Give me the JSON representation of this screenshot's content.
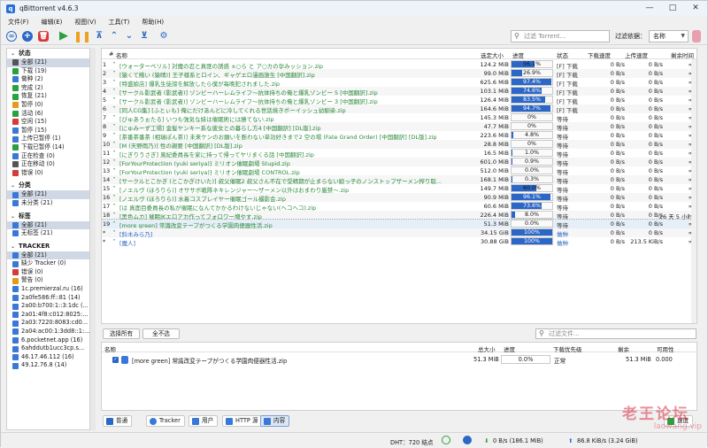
{
  "app": {
    "title": "qBittorrent v4.6.3"
  },
  "menu": [
    "文件(F)",
    "编辑(E)",
    "视图(V)",
    "工具(T)",
    "帮助(H)"
  ],
  "toolbar": {
    "filter_placeholder": "过滤 Torrent...",
    "filter_label": "过滤依据：",
    "filter_by": "名称"
  },
  "sidebar": {
    "status_title": "状态",
    "status": [
      {
        "label": "全部 (21)",
        "icon": "all-icon",
        "color": "#555555"
      },
      {
        "label": "下载 (19)",
        "icon": "download-icon",
        "color": "#2aa040"
      },
      {
        "label": "做种 (2)",
        "icon": "seed-icon",
        "color": "#3a78d8"
      },
      {
        "label": "完成 (2)",
        "icon": "check-icon",
        "color": "#2aa040"
      },
      {
        "label": "恢复 (21)",
        "icon": "resume-icon",
        "color": "#2aa040"
      },
      {
        "label": "暂停 (0)",
        "icon": "pause-icon",
        "color": "#e49a1a"
      },
      {
        "label": "活动 (6)",
        "icon": "active-icon",
        "color": "#2aa040"
      },
      {
        "label": "空闲 (15)",
        "icon": "idle-icon",
        "color": "#d43b3b"
      },
      {
        "label": "暂停 (15)",
        "icon": "stalled-icon",
        "color": "#3a78d8"
      },
      {
        "label": "上传已暂停 (1)",
        "icon": "upload-stalled-icon",
        "color": "#3a78d8"
      },
      {
        "label": "下载已暂停 (14)",
        "icon": "download-stalled-icon",
        "color": "#2aa040"
      },
      {
        "label": "正在检查 (0)",
        "icon": "checking-icon",
        "color": "#3a78d8"
      },
      {
        "label": "正在移动 (0)",
        "icon": "moving-icon",
        "color": "#555555"
      },
      {
        "label": "错误 (0)",
        "icon": "error-icon",
        "color": "#d43b3b"
      }
    ],
    "category_title": "分类",
    "category": [
      {
        "label": "全部 (21)",
        "icon": "folder-icon",
        "color": "#3a78d8"
      },
      {
        "label": "未分类 (21)",
        "icon": "folder-icon",
        "color": "#3a78d8"
      }
    ],
    "tag_title": "标签",
    "tag": [
      {
        "label": "全部 (21)",
        "icon": "tag-icon",
        "color": "#3a78d8"
      },
      {
        "label": "无标签 (21)",
        "icon": "tag-icon",
        "color": "#3a78d8"
      }
    ],
    "tracker_title": "TRACKER",
    "tracker": [
      {
        "label": "全部 (21)",
        "icon": "pin-icon",
        "color": "#3a78d8"
      },
      {
        "label": "缺少 Tracker (0)",
        "icon": "pin-icon",
        "color": "#3a78d8"
      },
      {
        "label": "错误 (0)",
        "icon": "error-icon",
        "color": "#d43b3b"
      },
      {
        "label": "警告 (0)",
        "icon": "warning-icon",
        "color": "#e49a1a"
      },
      {
        "label": "1c.premierzal.ru (16)",
        "icon": "pin-icon",
        "color": "#3a78d8"
      },
      {
        "label": "2a0fe586:ff::81 (14)",
        "icon": "pin-icon",
        "color": "#3a78d8"
      },
      {
        "label": "2a00:b700:1::3:1dc (...",
        "icon": "pin-icon",
        "color": "#3a78d8"
      },
      {
        "label": "2a01:4f8:c012:8025:...",
        "icon": "pin-icon",
        "color": "#3a78d8"
      },
      {
        "label": "2a03:7220:8083:cd0...",
        "icon": "pin-icon",
        "color": "#3a78d8"
      },
      {
        "label": "2a04:ac00:1:3dd8::1:...",
        "icon": "pin-icon",
        "color": "#3a78d8"
      },
      {
        "label": "6.pocketnet.app (16)",
        "icon": "pin-icon",
        "color": "#3a78d8"
      },
      {
        "label": "6ahddutb1ucc3cp.s...",
        "icon": "pin-icon",
        "color": "#3a78d8"
      },
      {
        "label": "46.17.46.112 (16)",
        "icon": "pin-icon",
        "color": "#3a78d8"
      },
      {
        "label": "49.12.76.8 (14)",
        "icon": "pin-icon",
        "color": "#3a78d8"
      }
    ]
  },
  "table": {
    "headers": {
      "num": "#",
      "name": "名称",
      "size": "选定大小",
      "progress": "进度",
      "status": "状态",
      "dl": "下载速度",
      "ul": "上传速度",
      "eta": "剩余时间"
    },
    "rows": [
      {
        "n": "1",
        "name": "[ウォーターベリル] 対魔の忍と真匪の誘惑 ±○ら と ア○カの孕みッション.zip",
        "size": "124.2 MiB",
        "progress": 56.1,
        "pt": "56.1%",
        "status": "[F] 下载",
        "dl": "0 B/s",
        "ul": "0 B/s",
        "eta": "∞"
      },
      {
        "n": "2",
        "name": "[猿くて賤い (猿晴)] 王子様系とロイン、ギャゲエロ漫画誰生 [中国翻訳].zip",
        "size": "99.0 MiB",
        "progress": 26.9,
        "pt": "26.9%",
        "status": "[F] 下载",
        "dl": "0 B/s",
        "ul": "0 B/s",
        "eta": "∞"
      },
      {
        "n": "3",
        "name": "[特盛娘店] 爆乳生徒諦を解放したら僕が毎晩犯されました.zip",
        "size": "625.6 MiB",
        "progress": 97.4,
        "pt": "97.4%",
        "status": "[F] 下载",
        "dl": "0 B/s",
        "ul": "0 B/s",
        "eta": "∞"
      },
      {
        "n": "4",
        "name": "[サークル影武者 (影武者)] ゾンビーハーレムライフ～抗体持ちの俺と爆乳ゾンビー 5 [中国翻訳].zip",
        "size": "103.1 MiB",
        "progress": 74.6,
        "pt": "74.6%",
        "status": "[F] 下载",
        "dl": "0 B/s",
        "ul": "0 B/s",
        "eta": "∞"
      },
      {
        "n": "5",
        "name": "[サークル影武者 (影武者)] ゾンビーハーレムライフ～抗体持ちの俺と爆乳ゾンビー 3 [中国翻訳].zip",
        "size": "126.4 MiB",
        "progress": 83.5,
        "pt": "83.5%",
        "status": "[F] 下载",
        "dl": "0 B/s",
        "ul": "0 B/s",
        "eta": "∞"
      },
      {
        "n": "6",
        "name": "[同人CG集] [ふとぃも] 俺にだけあんどに冷してくれる世話焼きボーイッシュ幼馴染.zip",
        "size": "164.6 MiB",
        "progress": 94.7,
        "pt": "94.7%",
        "status": "[F] 下载",
        "dl": "0 B/s",
        "ul": "0 B/s",
        "eta": "∞"
      },
      {
        "n": "7",
        "name": "[ぴゅあうぉたる] いつも強気な妹は催眠術には勝てない.zip",
        "size": "145.3 MiB",
        "progress": 0,
        "pt": "0%",
        "status": "等待",
        "dl": "0 B/s",
        "ul": "0 B/s",
        "eta": "∞"
      },
      {
        "n": "8",
        "name": "[にゅみーず工場] 金髪ヤンキー系な彼女との暮らし方4 [中国翻訳] [DL版].zip",
        "size": "47.7 MiB",
        "progress": 0,
        "pt": "0%",
        "status": "等待",
        "dl": "0 B/s",
        "ul": "0 B/s",
        "eta": "∞"
      },
      {
        "n": "9",
        "name": "[茶番茶番茶 (相瑞ぽん茶)] 未来ケンのお願いを断わない単効好きまで2 空の場 (Fate Grand Order) [中国翻訳] [DL版].zip",
        "size": "223.6 MiB",
        "progress": 4.8,
        "pt": "4.8%",
        "status": "等待",
        "dl": "0 B/s",
        "ul": "0 B/s",
        "eta": "∞"
      },
      {
        "n": "10",
        "name": "[M (天野雨乃)] 性の親要 [中国翻訳] [DL版].zip",
        "size": "28.8 MiB",
        "progress": 0,
        "pt": "0%",
        "status": "等待",
        "dl": "0 B/s",
        "ul": "0 B/s",
        "eta": "∞"
      },
      {
        "n": "11",
        "name": "[にぎりうさぎ] 風紀委員長を家に持って帰ってヤリまくる話 [中国翻訳].zip",
        "size": "16.5 MiB",
        "progress": 1.0,
        "pt": "1.0%",
        "status": "等待",
        "dl": "0 B/s",
        "ul": "0 B/s",
        "eta": "∞"
      },
      {
        "n": "12",
        "name": "[ForYourProtection (yuki seriya)] ミリオン催眠劇場 Stupid.zip",
        "size": "601.0 MiB",
        "progress": 0.9,
        "pt": "0.9%",
        "status": "等待",
        "dl": "0 B/s",
        "ul": "0 B/s",
        "eta": "∞"
      },
      {
        "n": "13",
        "name": "[ForYourProtection (yuki seriya)] ミリオン催眠劇場 CONTROL.zip",
        "size": "512.0 MiB",
        "progress": 0,
        "pt": "0.0%",
        "status": "等待",
        "dl": "0 B/s",
        "ul": "0 B/s",
        "eta": "∞"
      },
      {
        "n": "14",
        "name": "[サークルとこかぎ (とこかぎけいた)] 叔父催眠2 叔父さん不在で受精期が止まらない娘っ子のノンストップザーメン搾り取...",
        "size": "168.1 MiB",
        "progress": 0.3,
        "pt": "0.3%",
        "status": "等待",
        "dl": "0 B/s",
        "ul": "0 B/s",
        "eta": "∞"
      },
      {
        "n": "15",
        "name": "[ノエルヴ (ほろりら)] オササボ戦隊ネキレンジャー～ザーメン以外はおまわり厳禁～.zip",
        "size": "149.7 MiB",
        "progress": 60.0,
        "pt": "60.0%",
        "status": "等待",
        "dl": "0 B/s",
        "ul": "0 B/s",
        "eta": "∞"
      },
      {
        "n": "16",
        "name": "[ノエルヴ (ほろりら)] 水着コスプレイヤー催眠ゴール撮影会.zip",
        "size": "90.9 MiB",
        "progress": 96.1,
        "pt": "96.1%",
        "status": "等待",
        "dl": "0 B/s",
        "ul": "0 B/s",
        "eta": "∞"
      },
      {
        "n": "17",
        "name": "[は 真面目委員長の私が催眠になんてかかるわけないじゃない(ヘコヘコ).zip",
        "size": "60.6 MiB",
        "progress": 73.6,
        "pt": "73.6%",
        "status": "等待",
        "dl": "0 B/s",
        "ul": "0 B/s",
        "eta": "∞"
      },
      {
        "n": "18",
        "name": "[黑色ムカ] 催眠JKエロアカ作ってフォロワー増やす.zip",
        "size": "226.4 MiB",
        "progress": 8.0,
        "pt": "8.0%",
        "status": "等待",
        "dl": "0 B/s",
        "ul": "0 B/s",
        "eta": "26 天 5 小时"
      },
      {
        "n": "19",
        "name": "[more green] 常識改変テープがつくる学園肉便器性活.zip",
        "size": "51.3 MiB",
        "progress": 0,
        "pt": "0.0%",
        "status": "等待",
        "dl": "0 B/s",
        "ul": "0 B/s",
        "eta": "∞"
      },
      {
        "n": "*",
        "name": "[鈴木みら乃]",
        "size": "34.15 GiB",
        "progress": 100,
        "pt": "100%",
        "status": "做种",
        "dl": "0 B/s",
        "ul": "0 B/s",
        "eta": "∞"
      },
      {
        "n": "*",
        "name": "[魔人]",
        "size": "30.88 GiB",
        "progress": 100,
        "pt": "100%",
        "status": "做种",
        "dl": "0 B/s",
        "ul": "213.5 KiB/s",
        "eta": "∞"
      }
    ]
  },
  "lower": {
    "select_all": "选择所有",
    "select_none": "全不选",
    "filter_files_placeholder": "过滤文件...",
    "headers": {
      "name": "名称",
      "size": "总大小",
      "progress": "进度",
      "priority": "下载优先级",
      "remaining": "剩余",
      "availability": "可用性"
    },
    "file": {
      "name": "[more green] 常識改変テープがつくる学園肉便器性活.zip",
      "size": "51.3 MiB",
      "progress": "0.0%",
      "priority": "正常",
      "remaining": "51.3 MiB",
      "availability": "0.000"
    }
  },
  "tabs": [
    "普通",
    "Tracker",
    "用户",
    "HTTP 源",
    "内容"
  ],
  "tab_speed": "速度",
  "statusbar": {
    "dht": "DHT：720 结点",
    "down": "0 B/s (186.1 MiB)",
    "up": "86.8 KiB/s (3.24 GiB)"
  },
  "watermark": {
    "main": "老王论坛",
    "sub": "laowang.vip"
  }
}
